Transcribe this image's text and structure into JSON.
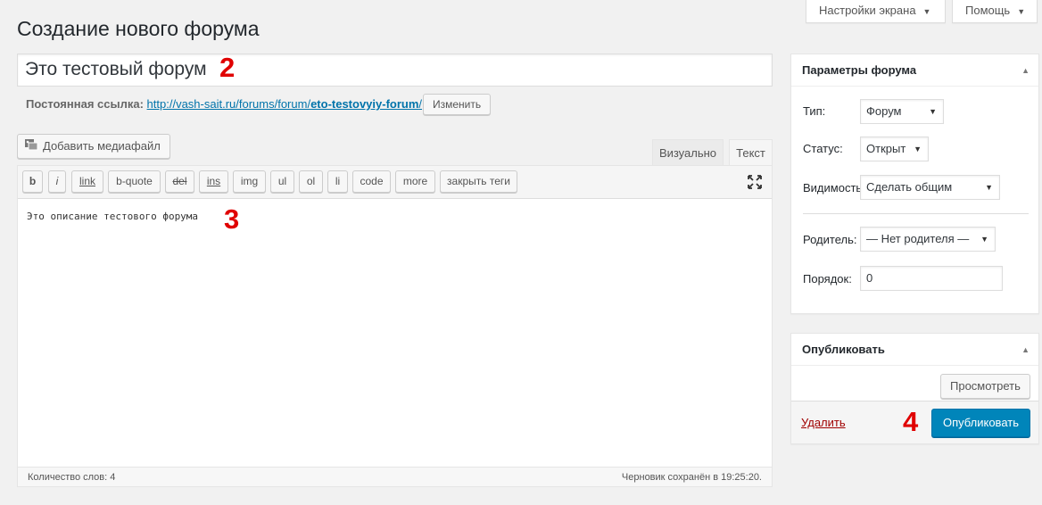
{
  "screen_options": {
    "label": "Настройки экрана"
  },
  "help": {
    "label": "Помощь"
  },
  "page_title": "Создание нового форума",
  "forum_title": {
    "value": "Это тестовый форум"
  },
  "annotations": {
    "a2": "2",
    "a3": "3",
    "a4": "4"
  },
  "permalink": {
    "label": "Постоянная ссылка:",
    "url_base": "http://vash-sait.ru/forums/forum/",
    "slug": "eto-testovyiy-forum",
    "trailing": "/",
    "edit_label": "Изменить"
  },
  "media": {
    "label": "Добавить медиафайл"
  },
  "editor": {
    "tab_visual": "Визуально",
    "tab_text": "Текст",
    "quicktags": {
      "b": "b",
      "i": "i",
      "link": "link",
      "bquote": "b-quote",
      "del": "del",
      "ins": "ins",
      "img": "img",
      "ul": "ul",
      "ol": "ol",
      "li": "li",
      "code": "code",
      "more": "more",
      "close": "закрыть теги"
    },
    "content": "Это описание тестового форума",
    "word_count": "Количество слов: 4",
    "draft_saved": "Черновик сохранён в 19:25:20."
  },
  "forum_params": {
    "title": "Параметры форума",
    "type_label": "Тип:",
    "type_value": "Форум",
    "status_label": "Статус:",
    "status_value": "Открыт",
    "visibility_label": "Видимость:",
    "visibility_value": "Сделать общим",
    "parent_label": "Родитель:",
    "parent_value": "— Нет родителя —",
    "order_label": "Порядок:",
    "order_value": "0"
  },
  "publish": {
    "title": "Опубликовать",
    "preview_label": "Просмотреть",
    "delete_label": "Удалить",
    "publish_label": "Опубликовать"
  },
  "colors": {
    "accent": "#0085ba",
    "link": "#0073aa",
    "annotation": "#e00000",
    "delete": "#a00000"
  }
}
